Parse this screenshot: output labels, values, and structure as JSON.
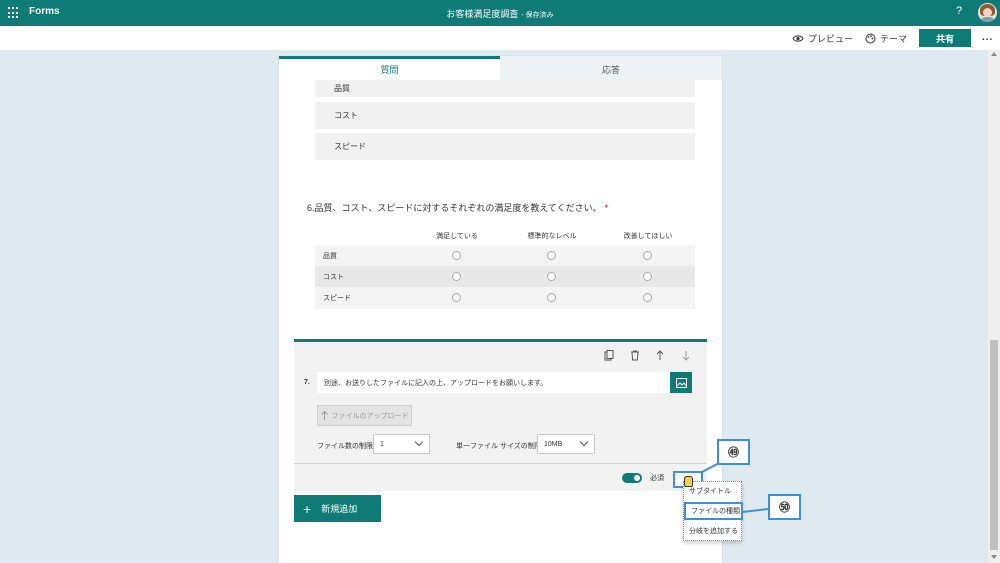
{
  "topbar": {
    "app_name": "Forms",
    "doc_title": "お客様満足度調査",
    "saved": "- 保存済み",
    "help": "?"
  },
  "cmdbar": {
    "preview": "プレビュー",
    "theme": "テーマ",
    "share": "共有",
    "more": "..."
  },
  "tabs": {
    "questions": "質問",
    "responses": "応答"
  },
  "q5_options": [
    "品質",
    "コスト",
    "スピード"
  ],
  "q6": {
    "title": "6.品質、コスト、スピードに対するそれぞれの満足度を教えてください。",
    "required_mark": "*",
    "columns": [
      "満足している",
      "標準的なレベル",
      "改善してほしい"
    ],
    "rows": [
      "品質",
      "コスト",
      "スピード"
    ]
  },
  "q7": {
    "number": "7.",
    "text": "別途、お送りしたファイルに記入の上、アップロードをお願いします。",
    "upload": "ファイルのアップロード",
    "file_count_label": "ファイル数の制限:",
    "file_count_value": "1",
    "file_size_label": "単一ファイル サイズの制限:",
    "file_size_value": "10MB",
    "required_label": "必須"
  },
  "add_button": "新規追加",
  "menu": {
    "items": [
      "サブタイトル",
      "ファイルの種類",
      "分岐を追加する"
    ]
  },
  "callouts": {
    "c49": "㊾",
    "c50": "㊿"
  },
  "colors": {
    "accent": "#0f7b77",
    "highlight": "#3f8fd8"
  }
}
